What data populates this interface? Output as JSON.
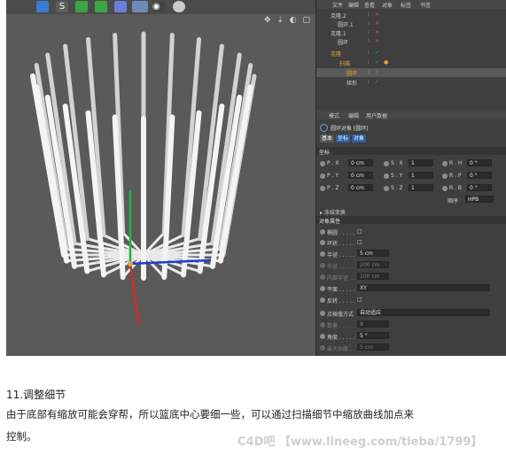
{
  "toolbar": {
    "icons": [
      "cube-icon",
      "spline-icon",
      "nurbs-icon",
      "array-icon",
      "deformer-icon",
      "floor-icon",
      "camera-icon",
      "light-icon"
    ]
  },
  "viewport": {
    "nav_icons": "✥ ⇣ ◐ ▢"
  },
  "object_manager": {
    "menu": [
      "文件",
      "编辑",
      "查看",
      "对象",
      "标签",
      "书签"
    ],
    "rows": [
      {
        "name": "克隆.2",
        "indent": 0
      },
      {
        "name": "圆环.1",
        "indent": 1
      },
      {
        "name": "克隆.1",
        "indent": 0
      },
      {
        "name": "圆环",
        "indent": 1
      },
      {
        "name": "克隆",
        "indent": 0
      },
      {
        "name": "扫描",
        "indent": 1
      },
      {
        "name": "圆环",
        "indent": 2
      },
      {
        "name": "矩形",
        "indent": 2
      }
    ]
  },
  "attributes": {
    "menu": [
      "模式",
      "编辑",
      "用户数据"
    ],
    "object_title": "圆环对象 [圆环]",
    "tabs": [
      "基本",
      "坐标",
      "对象"
    ],
    "coords_header": "坐标",
    "coords": [
      {
        "p_label": "P . X",
        "p_val": "0 cm",
        "s_label": "S . X",
        "s_val": "1",
        "r_label": "R . H",
        "r_val": "0 °"
      },
      {
        "p_label": "P . Y",
        "p_val": "0 cm",
        "s_label": "S . Y",
        "s_val": "1",
        "r_label": "R . P",
        "r_val": "0 °"
      },
      {
        "p_label": "P . Z",
        "p_val": "0 cm",
        "s_label": "S . Z",
        "s_val": "1",
        "r_label": "R . B",
        "r_val": "0 °"
      }
    ],
    "order_label": "顺序",
    "order_value": "HPB",
    "freeze_label": "▸ 冻结变换",
    "object_props_header": "对象属性",
    "props": [
      {
        "label": "椭圆 . . . . .",
        "value": "□",
        "type": "check"
      },
      {
        "label": "环状 . . . . .",
        "value": "□",
        "type": "check"
      },
      {
        "label": "半径 . . . . .",
        "value": "5 cm",
        "type": "field"
      },
      {
        "label": "半径 . . . . .",
        "value": "200 cm",
        "type": "field"
      },
      {
        "label": "内部半径 . .",
        "value": "100 cm",
        "type": "field"
      },
      {
        "label": "平面 . . . . .",
        "value": "XY",
        "type": "field"
      },
      {
        "label": "反转 . . . . .",
        "value": "□",
        "type": "check"
      }
    ],
    "interp_label": "点插值方式",
    "interp_value": "自动适应",
    "interp_props": [
      {
        "label": "数量 . . . . .",
        "value": "8"
      },
      {
        "label": "角度 . . . . .",
        "value": "5 °"
      },
      {
        "label": "最大长度 . .",
        "value": "5 cm"
      }
    ]
  },
  "caption": {
    "heading": "11.调整细节",
    "line1": "由于底部有缩放可能会穿帮，所以篮底中心要细一些，可以通过扫描细节中缩放曲线加点来",
    "line2": "控制。"
  },
  "watermark": "C4D吧 【www.lineeg.com/tieba/1799】",
  "colors": {
    "accent": "#e8a23a",
    "selected_tab": "#2b5f9e",
    "axis_x": "#1f3bd6",
    "axis_y": "#1fb34a",
    "axis_z": "#d62a2a"
  }
}
